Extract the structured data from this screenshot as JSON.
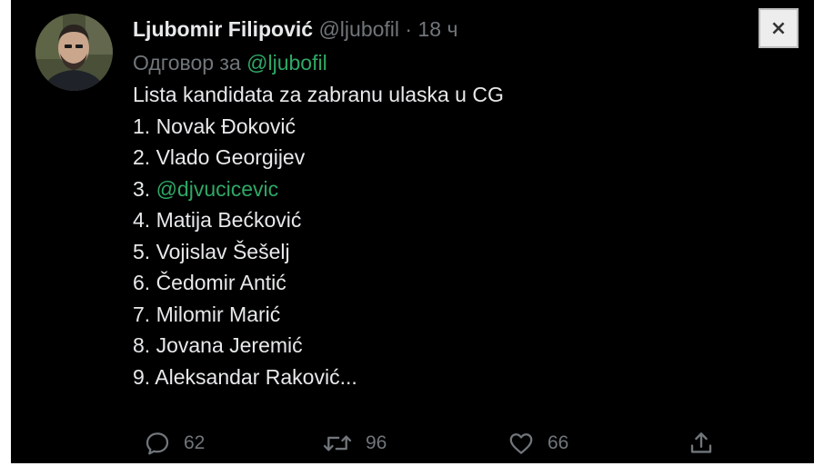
{
  "tweet": {
    "author_name": "Ljubomir Filipović",
    "handle": "@ljubofil",
    "separator": "·",
    "time": "18 ч",
    "reply_prefix": "Одговор за",
    "reply_to": "@ljubofil",
    "text_lines": [
      "Lista kandidata za zabranu ulaska u CG",
      "1. Novak Đoković",
      "2. Vlado Georgijev"
    ],
    "list_item_3_number": "3.",
    "list_item_3_mention": "@djvucicevic",
    "text_lines_rest": [
      "4. Matija Bećković",
      "5. Vojislav Šešelj",
      "6. Čedomir Antić",
      "7. Milomir Marić",
      "8. Jovana Jeremić",
      "9. Aleksandar Raković..."
    ]
  },
  "close_button": {
    "label": "×"
  },
  "actions": {
    "replies": "62",
    "retweets": "96",
    "likes": "66"
  },
  "colors": {
    "background": "#000000",
    "text": "#e7e9ea",
    "muted": "#71767b",
    "mention": "#2fa866"
  },
  "icons": {
    "reply": "reply-icon",
    "retweet": "retweet-icon",
    "like": "heart-icon",
    "share": "share-icon",
    "close": "close-icon"
  }
}
